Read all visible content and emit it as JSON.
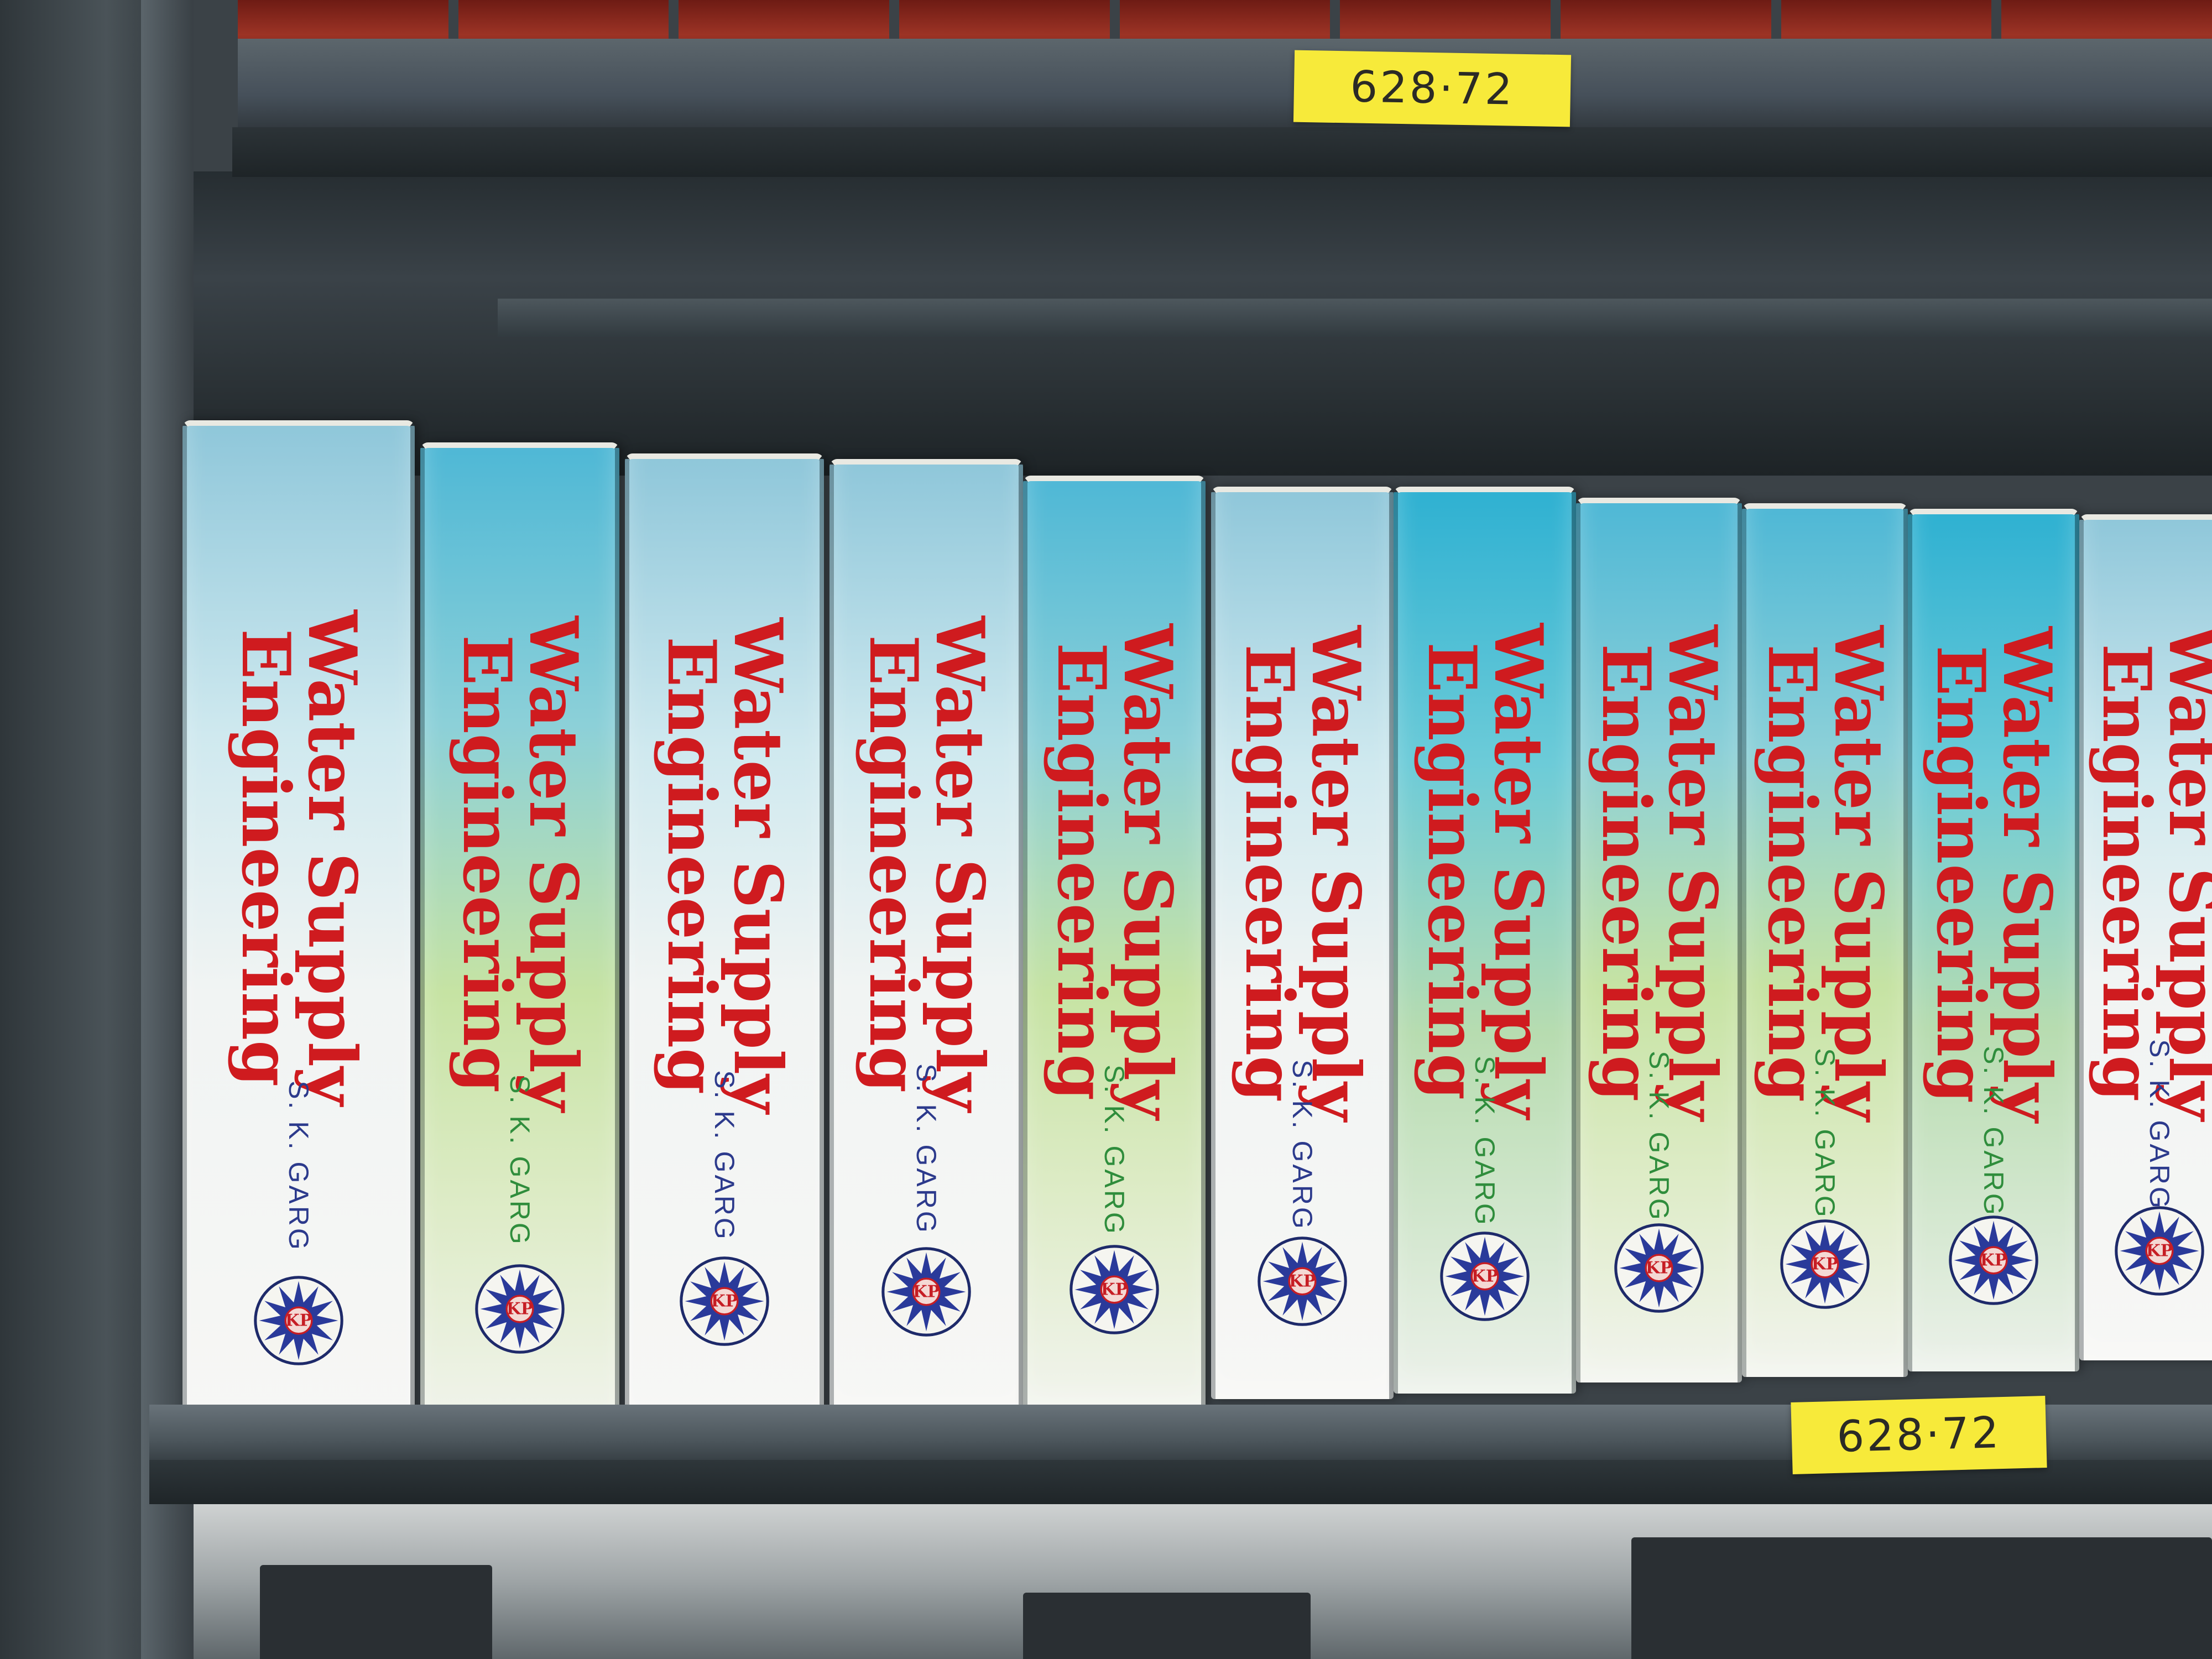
{
  "scene": {
    "description_tag": "library-shelf",
    "call_number_top": "628·72",
    "call_number_bottom": "628·72"
  },
  "books": [
    {
      "title_line1": "Water Supply",
      "title_line2": "Engineering",
      "author": "S. K. GARG",
      "publisher_mark": "KP",
      "variant": "white"
    },
    {
      "title_line1": "Water Supply",
      "title_line2": "Engineering",
      "author": "S. K. GARG",
      "publisher_mark": "KP",
      "variant": "green"
    },
    {
      "title_line1": "Water Supply",
      "title_line2": "Engineering",
      "author": "S. K. GARG",
      "publisher_mark": "KP",
      "variant": "white"
    },
    {
      "title_line1": "Water Supply",
      "title_line2": "Engineering",
      "author": "S. K. GARG",
      "publisher_mark": "KP",
      "variant": "white"
    },
    {
      "title_line1": "Water Supply",
      "title_line2": "Engineering",
      "author": "S. K. GARG",
      "publisher_mark": "KP",
      "variant": "green"
    },
    {
      "title_line1": "Water Supply",
      "title_line2": "Engineering",
      "author": "S. K. GARG",
      "publisher_mark": "KP",
      "variant": "white"
    },
    {
      "title_line1": "Water Supply",
      "title_line2": "Engineering",
      "author": "S. K. GARG",
      "publisher_mark": "KP",
      "variant": "teal"
    },
    {
      "title_line1": "Water Supply",
      "title_line2": "Engineering",
      "author": "S. K. GARG",
      "publisher_mark": "KP",
      "variant": "green"
    },
    {
      "title_line1": "Water Supply",
      "title_line2": "Engineering",
      "author": "S. K. GARG",
      "publisher_mark": "KP",
      "variant": "green"
    },
    {
      "title_line1": "Water Supply",
      "title_line2": "Engineering",
      "author": "S. K. GARG",
      "publisher_mark": "KP",
      "variant": "teal"
    },
    {
      "title_line1": "Water Supply",
      "title_line2": "Engineering",
      "author": "S. K. GARG",
      "publisher_mark": "KP",
      "variant": "white"
    }
  ],
  "colors": {
    "title_red": "#cf1b1f",
    "author_blue": "#2c3a8c",
    "author_green": "#2f8d3c",
    "tag_yellow": "#f7ea3a",
    "shelf_steel": "#4b555b"
  }
}
